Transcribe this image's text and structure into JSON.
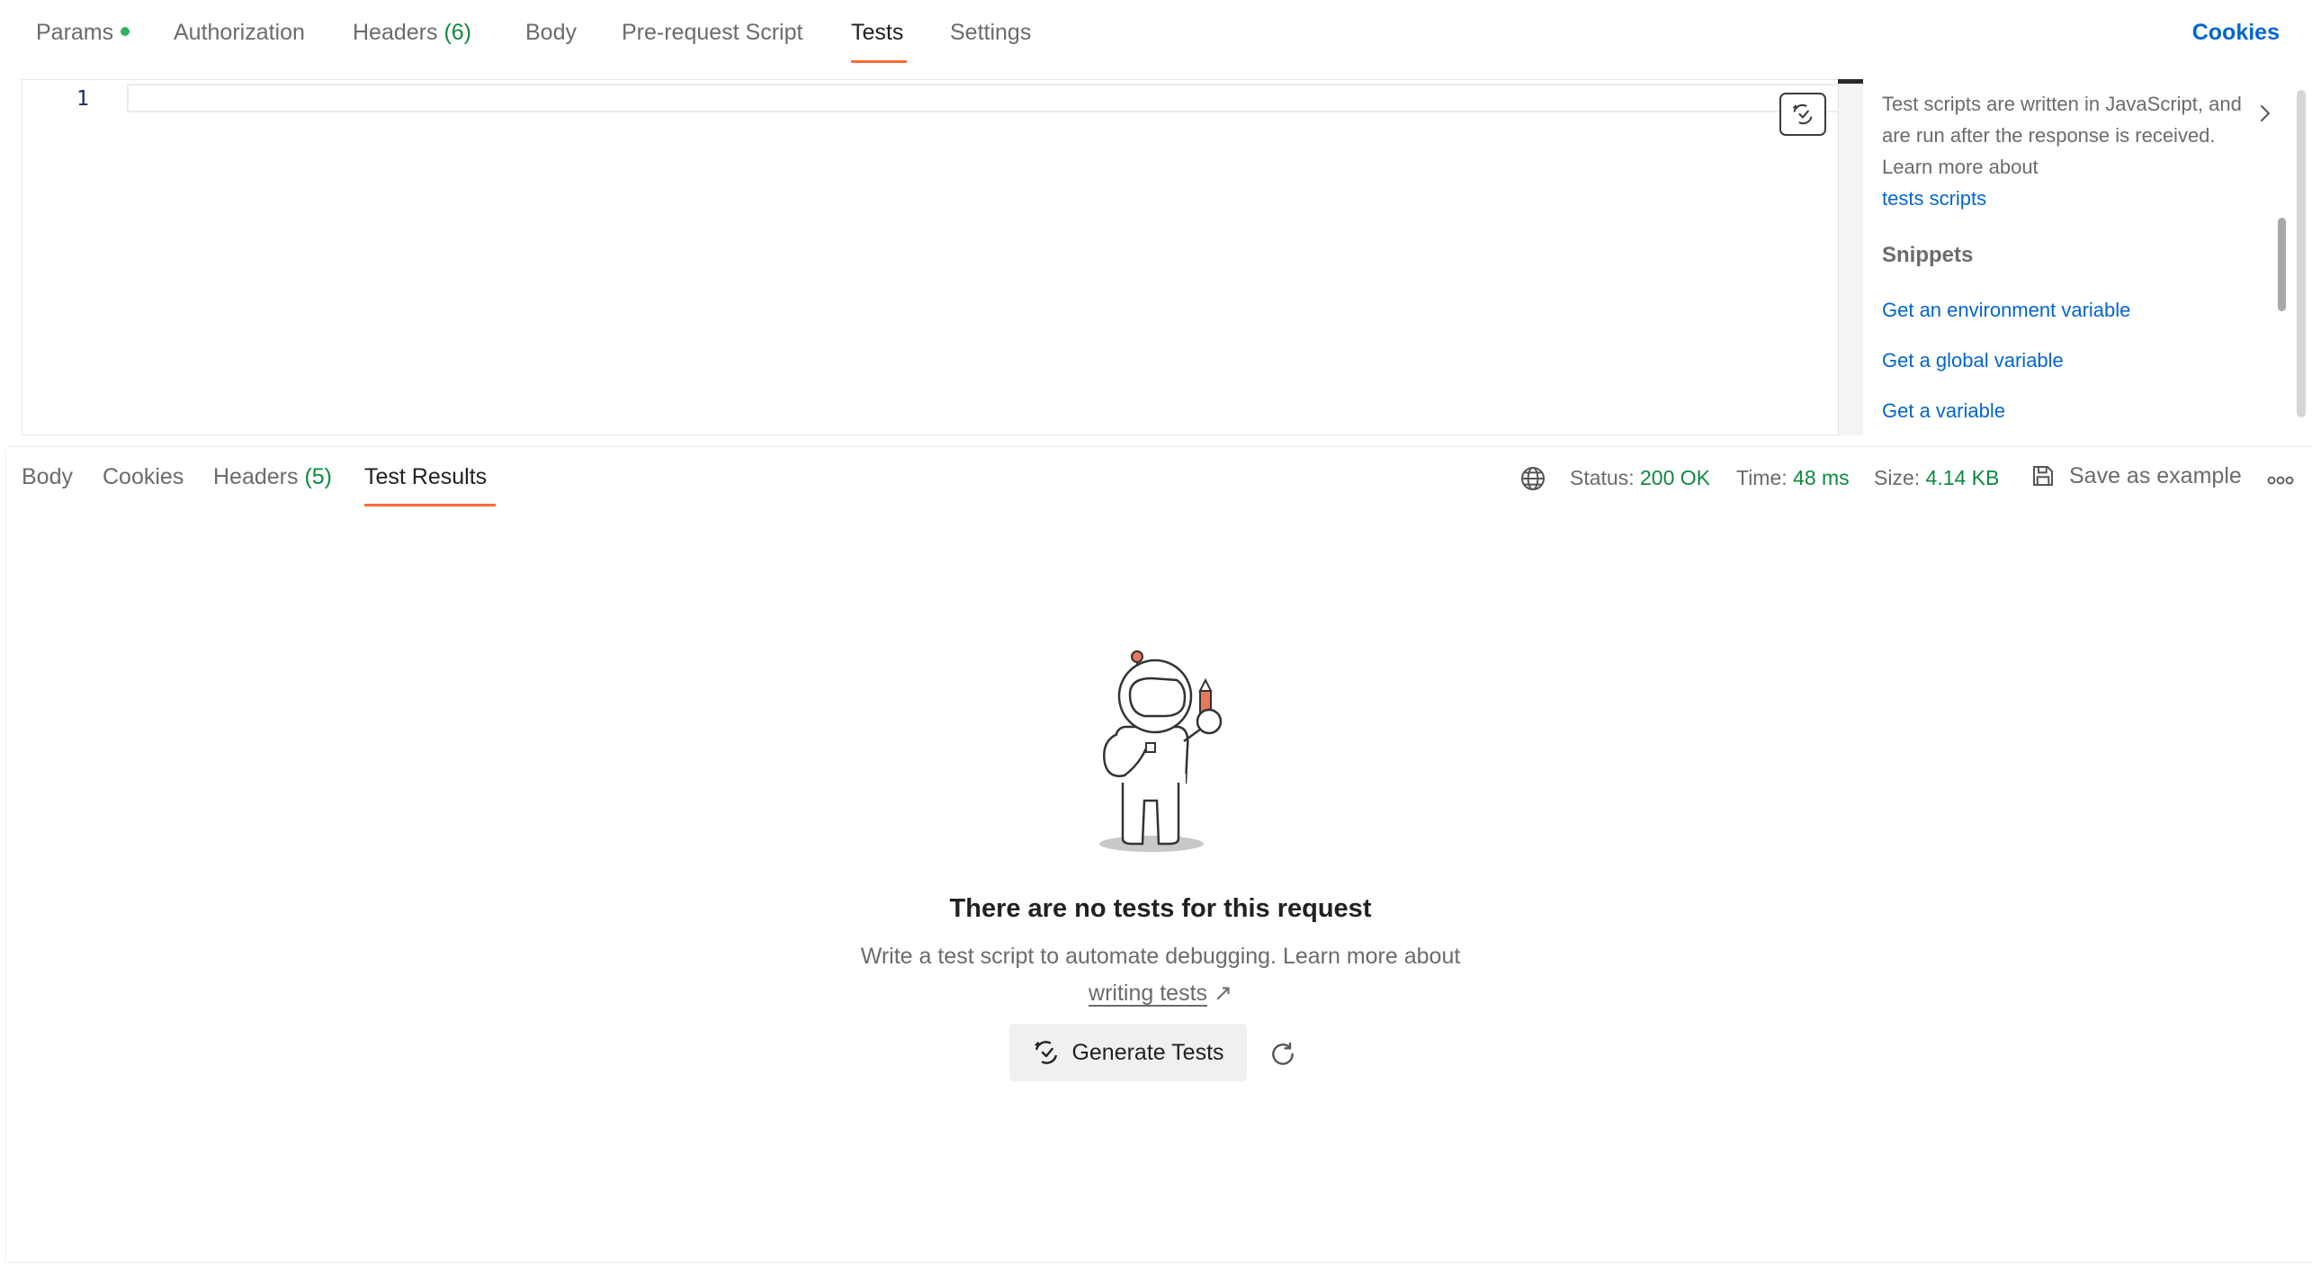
{
  "request_tabs": [
    {
      "label": "Params",
      "count": ""
    },
    {
      "label": "Authorization",
      "count": ""
    },
    {
      "label": "Headers",
      "count": "(6)"
    },
    {
      "label": "Body",
      "count": ""
    },
    {
      "label": "Pre-request Script",
      "count": ""
    },
    {
      "label": "Tests",
      "count": ""
    },
    {
      "label": "Settings",
      "count": ""
    }
  ],
  "active_request_tab": "Tests",
  "cookies_link": "Cookies",
  "editor": {
    "line_number": "1"
  },
  "side_panel": {
    "description": "Test scripts are written in JavaScript, and are run after the response is received. Learn more about",
    "link": "tests scripts",
    "snippets_title": "Snippets",
    "snippets": [
      "Get an environment variable",
      "Get a global variable",
      "Get a variable"
    ]
  },
  "response_tabs": [
    {
      "label": "Body",
      "count": ""
    },
    {
      "label": "Cookies",
      "count": ""
    },
    {
      "label": "Headers",
      "count": "(5)"
    },
    {
      "label": "Test Results",
      "count": ""
    }
  ],
  "active_response_tab": "Test Results",
  "response_meta": {
    "status_label": "Status:",
    "status_value": "200 OK",
    "time_label": "Time:",
    "time_value": "48 ms",
    "size_label": "Size:",
    "size_value": "4.14 KB"
  },
  "save_example": "Save as example",
  "empty_state": {
    "title": "There are no tests for this request",
    "description": "Write a test script to automate debugging. Learn more about",
    "link": "writing tests",
    "link_arrow": "↗",
    "button": "Generate Tests"
  },
  "colors": {
    "accent": "#ff6c37",
    "link": "#0265d2",
    "success": "#0c8a3e"
  }
}
